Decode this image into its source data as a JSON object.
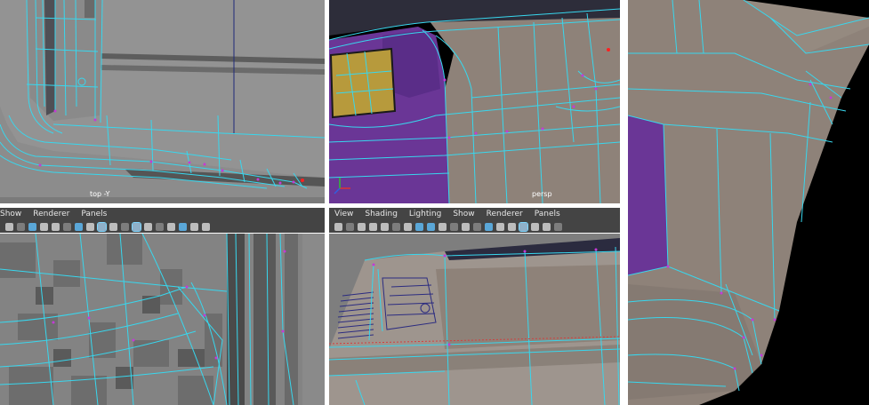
{
  "viewports": {
    "top_left": {
      "camera_label": "top -Y"
    },
    "top_mid": {
      "camera_label": "persp"
    }
  },
  "panel_menus": {
    "left": [
      "Show",
      "Renderer",
      "Panels"
    ],
    "mid": [
      "View",
      "Shading",
      "Lighting",
      "Show",
      "Renderer",
      "Panels"
    ]
  },
  "colors": {
    "wire": "#38d7ee",
    "vertex": "#c43ad6",
    "mesh_gray": "#8f8f8f",
    "mesh_tan": "#8e8279",
    "purple": "#6a3696",
    "yellow": "#b79a3c",
    "menubar": "#444444",
    "viewport_bg": "#7d7d7d"
  },
  "icons": [
    "camera-icon",
    "grid-icon",
    "wireframe-icon",
    "smooth-shade-icon",
    "texture-icon",
    "light-icon",
    "shadow-icon",
    "isolate-icon",
    "xray-icon",
    "resolution-gate-icon",
    "film-gate-icon"
  ]
}
